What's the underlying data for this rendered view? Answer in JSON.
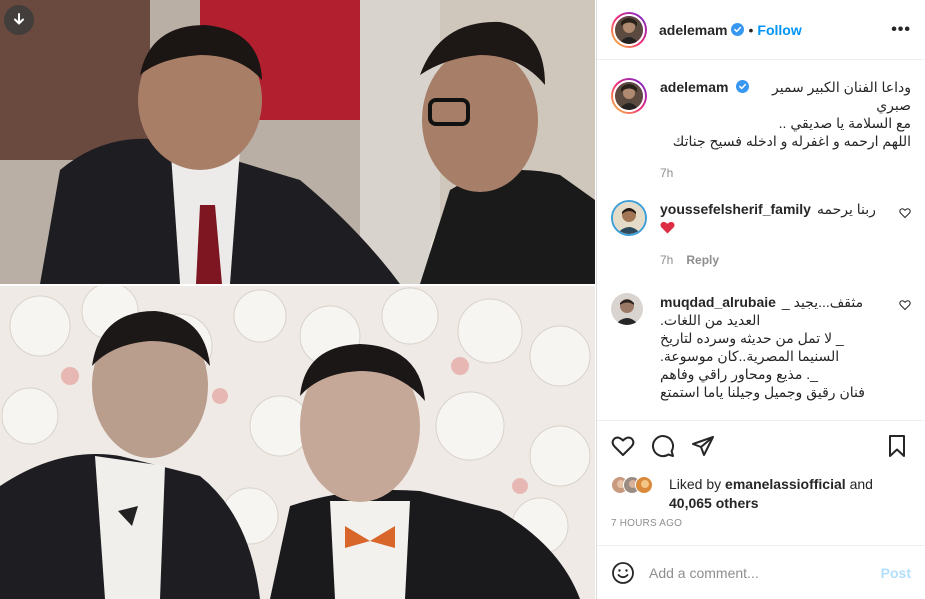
{
  "post": {
    "author": "adelemam",
    "follow_label": "Follow",
    "separator": "•",
    "more_label": "•••"
  },
  "caption": {
    "author": "adelemam",
    "lines": [
      "وداعا الفنان الكبير سمير صبري",
      "مع السلامة يا صديقي ..",
      "اللهم ارحمه و اغفرله و ادخله فسيح جناتك"
    ],
    "time": "7h"
  },
  "comments": [
    {
      "author": "youssefelsherif_family",
      "text": "ربنا يرحمه",
      "emoji": "❤️",
      "time": "7h",
      "reply_label": "Reply"
    },
    {
      "author": "muqdad_alrubaie",
      "lines": [
        "مثقف...يجيد _",
        "العديد من اللغات.",
        "_ لا تمل من حديثه وسرده لتاريخ",
        "السنيما المصرية..كان موسوعة.",
        "_. مذيع ومحاور راقي وفاهم",
        "فنان رقيق وجميل وجيلنا ياما استمتع"
      ]
    }
  ],
  "likes": {
    "prefix": "Liked by",
    "user": "emanelassiofficial",
    "and": "and",
    "count": "40,065 others"
  },
  "timestamp": "7 HOURS AGO",
  "composer": {
    "placeholder": "Add a comment...",
    "post_label": "Post"
  },
  "colors": {
    "accent": "#0095f6",
    "text": "#262626",
    "muted": "#8e8e8e",
    "border": "#dbdbdb",
    "like_red": "#ed4956"
  },
  "icons": [
    "download-icon",
    "verified-icon",
    "more-icon",
    "heart-icon",
    "comment-icon",
    "share-icon",
    "bookmark-icon",
    "emoji-icon"
  ]
}
